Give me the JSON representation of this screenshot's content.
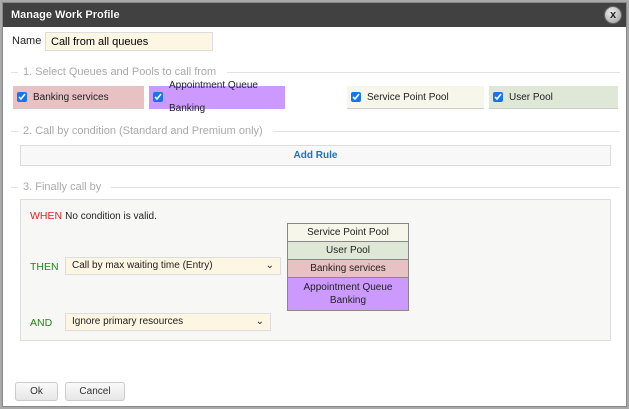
{
  "dialog": {
    "title": "Manage Work Profile",
    "close": "x"
  },
  "name": {
    "label": "Name",
    "value": "Call from all queues"
  },
  "section1": {
    "legend": "1. Select Queues and Pools to call from",
    "items": [
      {
        "label": "Banking services",
        "checked": true,
        "color": "#e8c2c2"
      },
      {
        "label": "Appointment Queue Banking",
        "checked": true,
        "color": "#cc99ff"
      },
      {
        "label": "Service Point Pool",
        "checked": true,
        "color": "#f6f6ea"
      },
      {
        "label": "User Pool",
        "checked": true,
        "color": "#dfe8d7"
      }
    ]
  },
  "section2": {
    "legend": "2. Call by condition (Standard and Premium only)",
    "add_rule": "Add Rule"
  },
  "section3": {
    "legend": "3. Finally call by",
    "when": "WHEN",
    "when_text": "No condition is valid.",
    "then": "THEN",
    "then_value": "Call by max waiting time (Entry)",
    "and": "AND",
    "and_value": "Ignore primary resources",
    "order": [
      "Service Point Pool",
      "User Pool",
      "Banking services",
      "Appointment Queue Banking"
    ]
  },
  "buttons": {
    "ok": "Ok",
    "cancel": "Cancel"
  }
}
